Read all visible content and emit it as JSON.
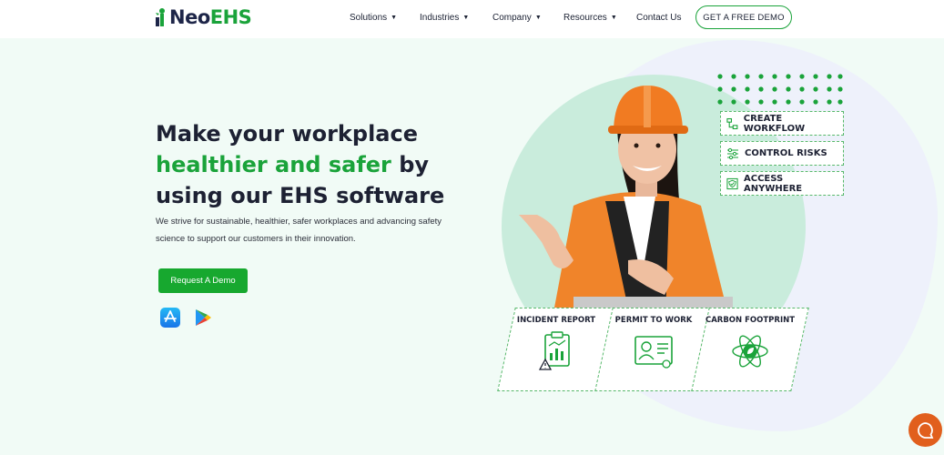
{
  "brand": {
    "name_part1": "Neo",
    "name_part2": "EHS"
  },
  "nav": {
    "items": [
      {
        "label": "Solutions",
        "has_dropdown": true
      },
      {
        "label": "Industries",
        "has_dropdown": true
      },
      {
        "label": "Company",
        "has_dropdown": true
      },
      {
        "label": "Resources",
        "has_dropdown": true
      },
      {
        "label": "Contact Us",
        "has_dropdown": false
      }
    ],
    "demo_button": "GET A FREE DEMO"
  },
  "hero": {
    "title_line1": "Make your workplace",
    "title_green": "healthier and safer",
    "title_after_green": " by",
    "title_line3": "using our EHS software",
    "subtitle_line1": "We strive for sustainable, healthier, safer workplaces and advancing safety",
    "subtitle_line2": "science to support our customers in their innovation.",
    "cta": "Request A Demo"
  },
  "app_badges": [
    {
      "name": "app-store-icon"
    },
    {
      "name": "google-play-icon"
    }
  ],
  "features": [
    {
      "label": "CREATE WORKFLOW",
      "icon": "workflow-icon"
    },
    {
      "label": "CONTROL RISKS",
      "icon": "sliders-icon"
    },
    {
      "label": "ACCESS ANYWHERE",
      "icon": "shield-check-icon"
    }
  ],
  "cards": [
    {
      "label": "INCIDENT REPORT",
      "icon": "clipboard-chart-icon"
    },
    {
      "label": "PERMIT TO WORK",
      "icon": "id-card-icon"
    },
    {
      "label": "CARBON FOOTPRINT",
      "icon": "atom-leaf-icon"
    }
  ],
  "colors": {
    "brand_green": "#1aa33a",
    "brand_navy": "#1d2548",
    "chat_orange": "#e15f1d",
    "background": "#f1fbf6"
  }
}
